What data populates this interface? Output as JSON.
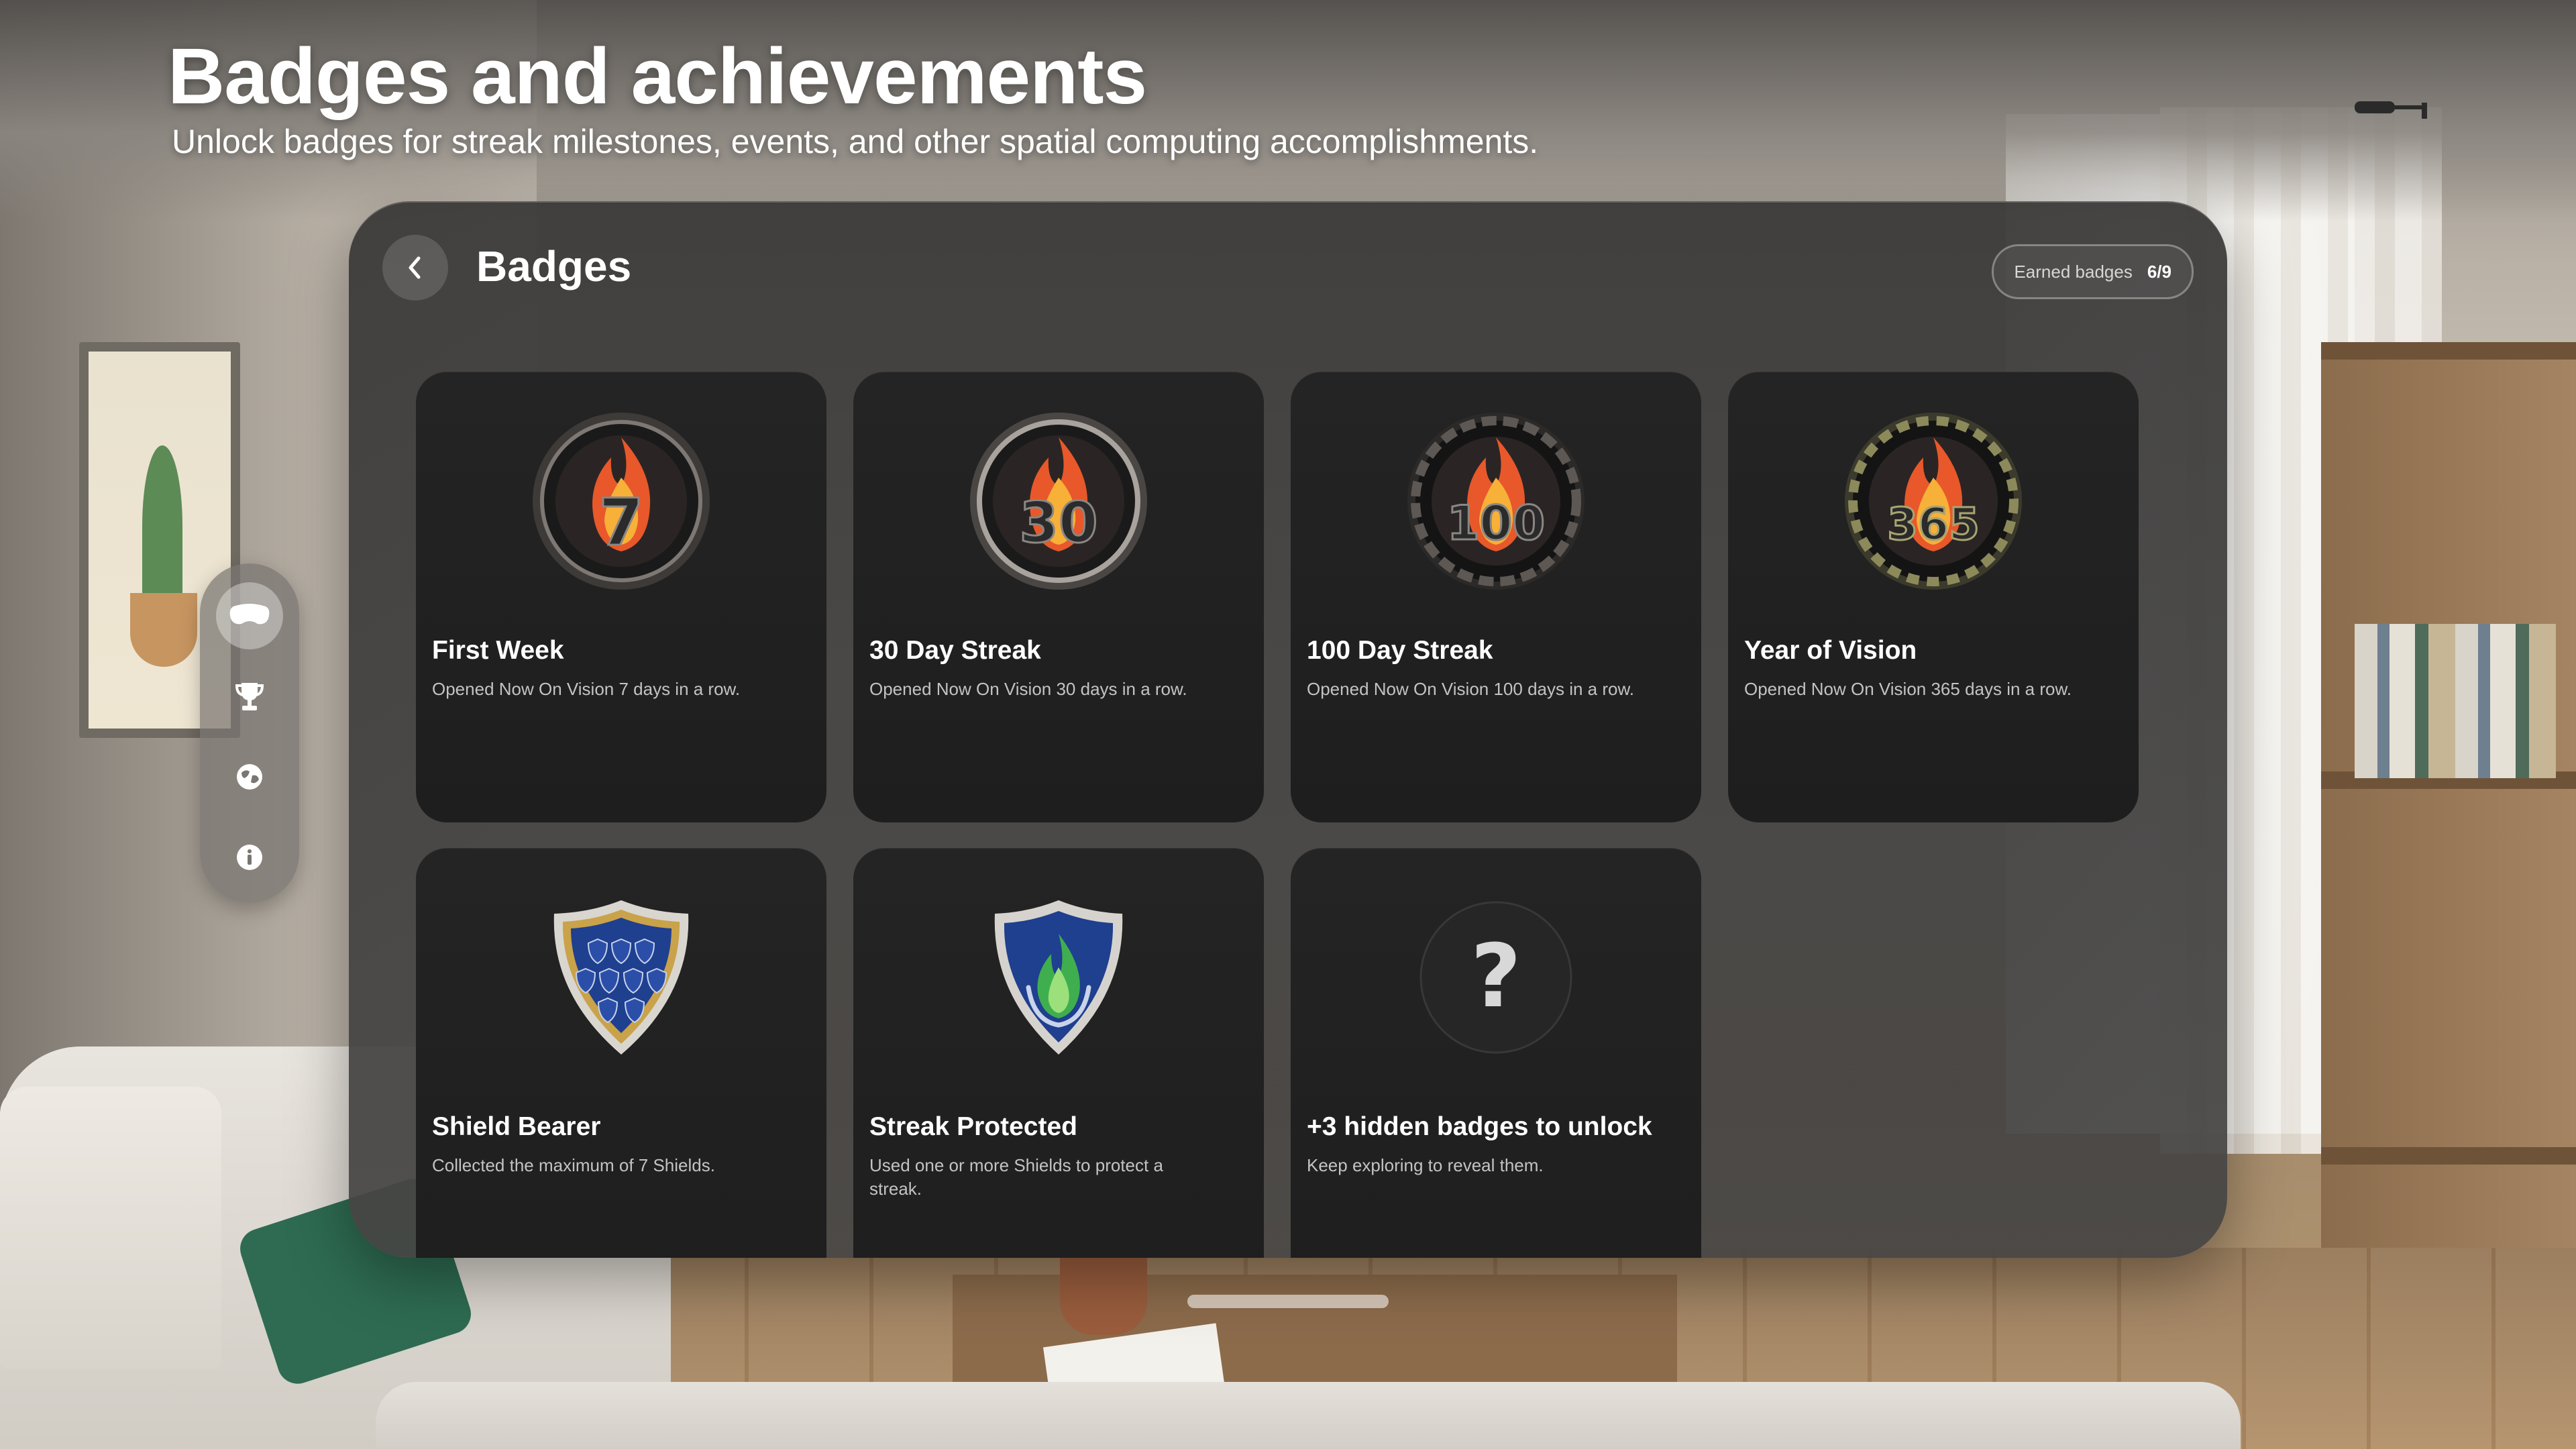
{
  "header": {
    "title": "Badges and achievements",
    "subtitle": "Unlock badges for streak milestones, events, and other spatial computing accomplishments."
  },
  "window": {
    "back_icon": "chevron-left-icon",
    "title": "Badges",
    "earned": {
      "label": "Earned badges",
      "value": "6/9"
    }
  },
  "badges": [
    {
      "name": "First Week",
      "description": "Opened Now On Vision 7 days in a row.",
      "icon": "flame-medal-icon",
      "number": "7"
    },
    {
      "name": "30 Day Streak",
      "description": "Opened Now On Vision 30 days in a row.",
      "icon": "flame-medal-icon",
      "number": "30"
    },
    {
      "name": "100 Day Streak",
      "description": "Opened Now On Vision 100 days in a row.",
      "icon": "flame-medal-icon",
      "number": "100"
    },
    {
      "name": "Year of Vision",
      "description": "Opened Now On Vision 365 days in a row.",
      "icon": "flame-medal-icon",
      "number": "365"
    },
    {
      "name": "Shield Bearer",
      "description": "Collected the maximum of 7 Shields.",
      "icon": "shield-cluster-icon"
    },
    {
      "name": "Streak Protected",
      "description": "Used one or more Shields to protect a streak.",
      "icon": "shield-flame-icon"
    },
    {
      "name": "+3 hidden badges to unlock",
      "description": "Keep exploring to reveal them.",
      "icon": "question-mark-icon",
      "glyph": "?"
    }
  ],
  "ornament": [
    {
      "name": "vision-pro-icon",
      "active": true
    },
    {
      "name": "trophy-icon",
      "active": false
    },
    {
      "name": "globe-icon",
      "active": false
    },
    {
      "name": "info-icon",
      "active": false
    }
  ],
  "colors": {
    "window_bg": "#3a3938",
    "card_bg": "#222222",
    "flame": "#e8582a",
    "shield_blue": "#1f3f8f",
    "shield_gold": "#c9a24a",
    "shield_green": "#3fae4f"
  }
}
